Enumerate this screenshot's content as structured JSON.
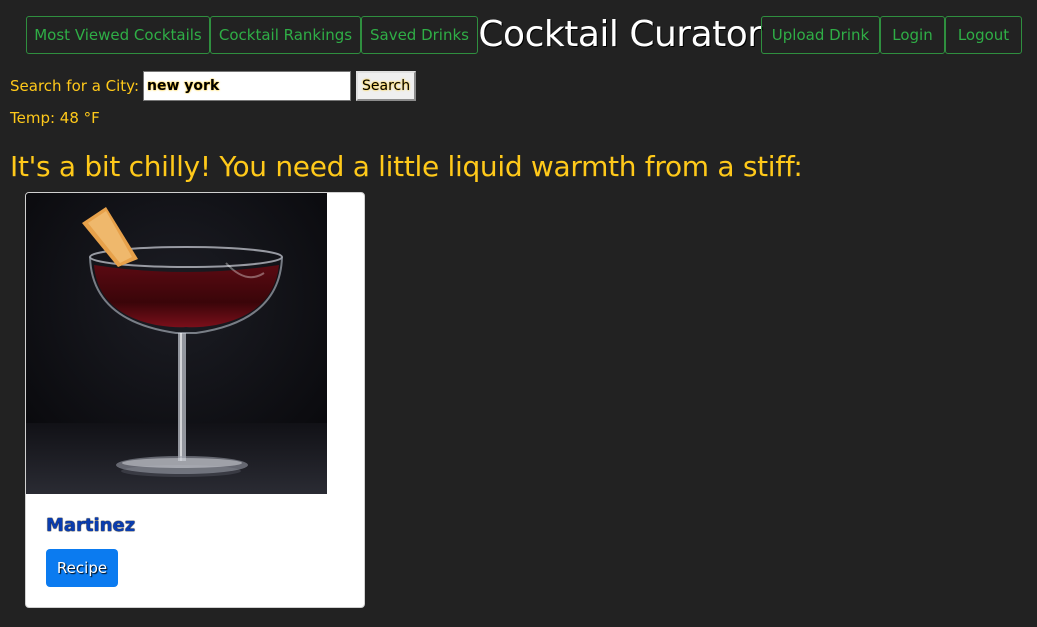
{
  "header": {
    "title": "Cocktail Curator",
    "nav_left": [
      "Most Viewed Cocktails",
      "Cocktail Rankings",
      "Saved Drinks"
    ],
    "nav_right": [
      "Upload Drink",
      "Login",
      "Logout"
    ]
  },
  "search": {
    "label": "Search for a City:",
    "value": "new york",
    "button_label": "Search"
  },
  "weather": {
    "temp_text": "Temp: 48 °F"
  },
  "message": "It's a bit chilly! You need a little liquid warmth from a stiff:",
  "drink": {
    "name": "Martinez",
    "button_label": "Recipe",
    "image_icon": "cocktail-coupe-image"
  },
  "colors": {
    "background": "#222222",
    "nav_green": "#2fae46",
    "accent_yellow": "#ffc91a",
    "button_blue": "#0b7bf0"
  }
}
